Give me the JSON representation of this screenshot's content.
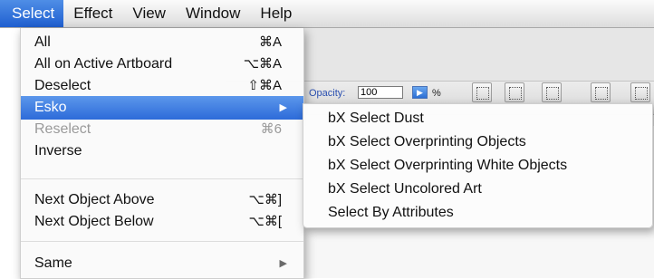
{
  "menubar": {
    "items": [
      {
        "label": "Select",
        "active": true
      },
      {
        "label": "Effect"
      },
      {
        "label": "View"
      },
      {
        "label": "Window"
      },
      {
        "label": "Help"
      }
    ]
  },
  "control_bar": {
    "opacity_label": "Opacity:",
    "opacity_value": "100",
    "opacity_unit": "%"
  },
  "select_menu": {
    "items": [
      {
        "label": "All",
        "shortcut": "⌘A"
      },
      {
        "label": "All on Active Artboard",
        "shortcut": "⌥⌘A"
      },
      {
        "label": "Deselect",
        "shortcut": "⇧⌘A"
      },
      {
        "label": "Esko",
        "submenu": true,
        "highlighted": true
      },
      {
        "label": "Reselect",
        "shortcut": "⌘6",
        "disabled": true
      },
      {
        "label": "Inverse"
      },
      {
        "label": "Next Object Above",
        "shortcut": "⌥⌘]"
      },
      {
        "label": "Next Object Below",
        "shortcut": "⌥⌘["
      },
      {
        "label": "Same",
        "submenu": true
      }
    ],
    "submenu_arrow": "▶"
  },
  "esko_submenu": {
    "items": [
      {
        "label": "bX Select Dust"
      },
      {
        "label": "bX Select Overprinting Objects"
      },
      {
        "label": "bX Select Overprinting White Objects"
      },
      {
        "label": "bX Select Uncolored Art"
      },
      {
        "label": "Select By Attributes"
      }
    ]
  },
  "colors": {
    "highlight": "#2d6bd9",
    "disabled_text": "#9a9a9a"
  }
}
